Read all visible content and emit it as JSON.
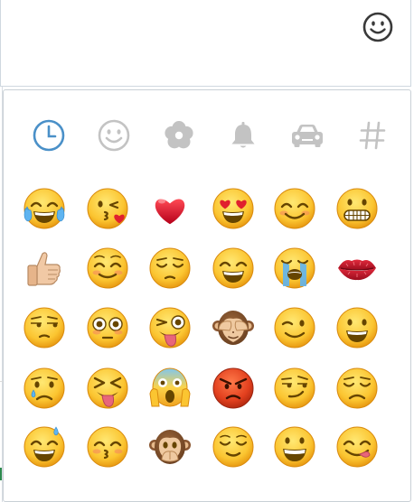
{
  "input": {
    "emoji_button_icon": "smiley-outline-icon"
  },
  "picker": {
    "tabs": [
      {
        "name": "recent",
        "icon": "clock-icon",
        "active": true
      },
      {
        "name": "people",
        "icon": "smiley-icon",
        "active": false
      },
      {
        "name": "nature",
        "icon": "flower-icon",
        "active": false
      },
      {
        "name": "objects",
        "icon": "bell-icon",
        "active": false
      },
      {
        "name": "places",
        "icon": "car-icon",
        "active": false
      },
      {
        "name": "symbols",
        "icon": "hash-icon",
        "active": false
      }
    ],
    "colors": {
      "active_tab": "#4a90c8",
      "inactive_tab": "#c3c3c3",
      "border": "#c9d0d6"
    },
    "emojis": [
      {
        "name": "face-with-tears-of-joy",
        "kind": "joy"
      },
      {
        "name": "face-throwing-a-kiss",
        "kind": "kissheart"
      },
      {
        "name": "red-heart",
        "kind": "heart"
      },
      {
        "name": "smiling-face-with-heart-eyes",
        "kind": "hearteyes"
      },
      {
        "name": "smiling-face-with-smiling-eyes",
        "kind": "blush"
      },
      {
        "name": "grimacing-face",
        "kind": "grimace"
      },
      {
        "name": "thumbs-up",
        "kind": "thumbsup"
      },
      {
        "name": "smiling-face",
        "kind": "relaxed"
      },
      {
        "name": "pensive-face",
        "kind": "pensive"
      },
      {
        "name": "smiling-face-with-open-mouth-and-smiling-eyes",
        "kind": "smile"
      },
      {
        "name": "loudly-crying-face",
        "kind": "sob"
      },
      {
        "name": "kiss-mark",
        "kind": "lips"
      },
      {
        "name": "unamused-face",
        "kind": "unamused"
      },
      {
        "name": "flushed-face",
        "kind": "flushed"
      },
      {
        "name": "face-with-stuck-out-tongue-and-winking-eye",
        "kind": "tonguewink"
      },
      {
        "name": "see-no-evil-monkey",
        "kind": "monkeyeyes"
      },
      {
        "name": "winking-face",
        "kind": "wink"
      },
      {
        "name": "smiling-face-with-open-mouth",
        "kind": "smiley"
      },
      {
        "name": "crying-face",
        "kind": "cry"
      },
      {
        "name": "face-with-stuck-out-tongue-and-tightly-closed-eyes",
        "kind": "tonguesquint"
      },
      {
        "name": "face-screaming-in-fear",
        "kind": "scream"
      },
      {
        "name": "pouting-face",
        "kind": "rage"
      },
      {
        "name": "smirking-face",
        "kind": "smirk"
      },
      {
        "name": "disappointed-face",
        "kind": "disappointed"
      },
      {
        "name": "smiling-face-with-open-mouth-and-cold-sweat",
        "kind": "sweatsmile"
      },
      {
        "name": "kissing-face-with-smiling-eyes",
        "kind": "kissingsmile"
      },
      {
        "name": "speak-no-evil-monkey",
        "kind": "monkeymouth"
      },
      {
        "name": "relieved-face",
        "kind": "relieved"
      },
      {
        "name": "grinning-face",
        "kind": "grin"
      },
      {
        "name": "face-savouring-delicious-food",
        "kind": "yum"
      }
    ]
  }
}
